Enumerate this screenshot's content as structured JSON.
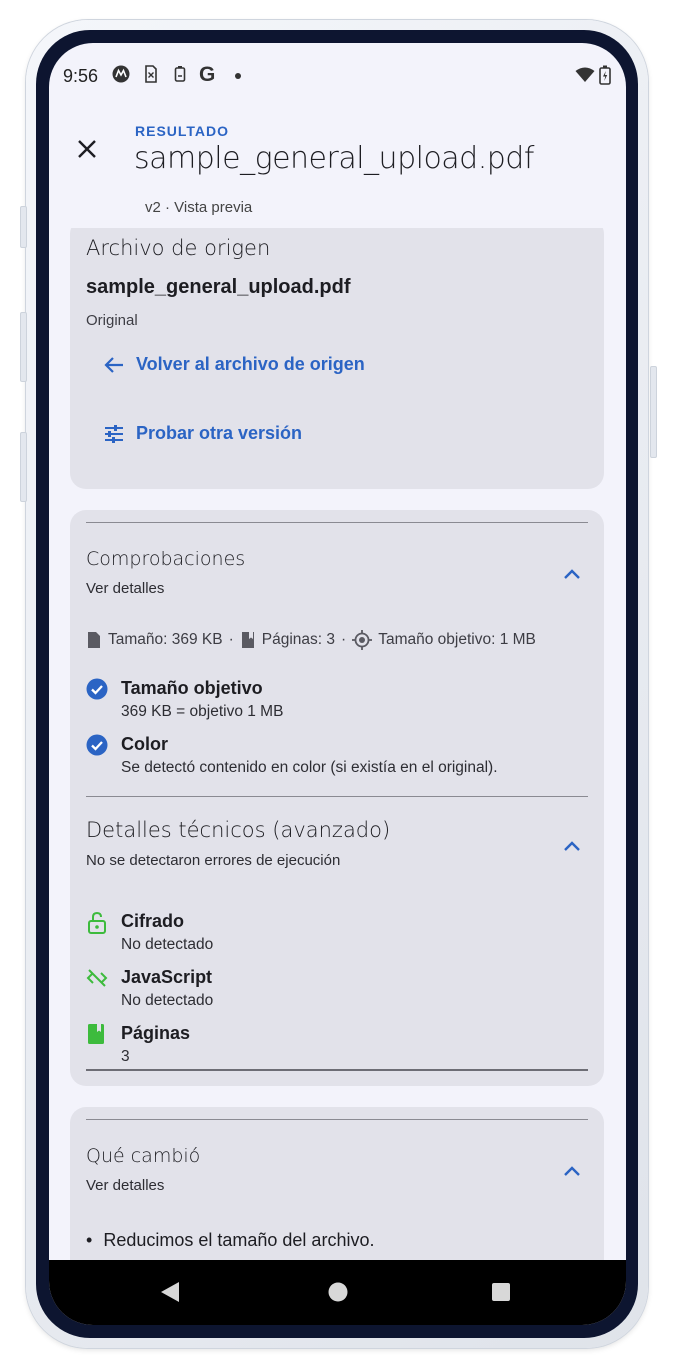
{
  "status_bar": {
    "time": "9:56",
    "icons": [
      "motorola-icon",
      "sim-x-icon",
      "battery-saver-icon",
      "google-icon",
      "dot",
      "wifi-icon",
      "battery-icon"
    ]
  },
  "header": {
    "close_icon": "close-icon",
    "eyebrow": "RESULTADO",
    "title": "sample_general_upload.pdf",
    "subtitle": "v2 · Vista previa"
  },
  "source_card": {
    "heading": "Archivo de origen",
    "file_name": "sample_general_upload.pdf",
    "file_tag": "Original",
    "back_link": "Volver al archivo de origen",
    "try_link": "Probar otra versión"
  },
  "checks_card": {
    "heading": "Comprobaciones",
    "sub": "Ver detalles",
    "meta": {
      "size": "Tamaño: 369 KB",
      "pages": "Páginas: 3",
      "target": "Tamaño objetivo: 1 MB",
      "sep": "·"
    },
    "checks": [
      {
        "label": "Tamaño objetivo",
        "desc": "369 KB = objetivo 1 MB"
      },
      {
        "label": "Color",
        "desc": "Se detectó contenido en color (si existía en el original)."
      }
    ],
    "tech": {
      "heading": "Detalles técnicos (avanzado)",
      "sub": "No se detectaron errores de ejecución",
      "items": [
        {
          "label": "Cifrado",
          "desc": "No detectado"
        },
        {
          "label": "JavaScript",
          "desc": "No detectado"
        },
        {
          "label": "Páginas",
          "desc": "3"
        }
      ]
    }
  },
  "changes_card": {
    "heading": "Qué cambió",
    "sub": "Ver detalles",
    "bullet": "•",
    "items": [
      "Reducimos el tamaño del archivo."
    ]
  },
  "colors": {
    "accent": "#2b64c4",
    "success_green": "#3dbb3d",
    "card_bg": "#e2e2ea",
    "screen_bg": "#f3f3fb",
    "frame_bezel": "#0d1530"
  }
}
